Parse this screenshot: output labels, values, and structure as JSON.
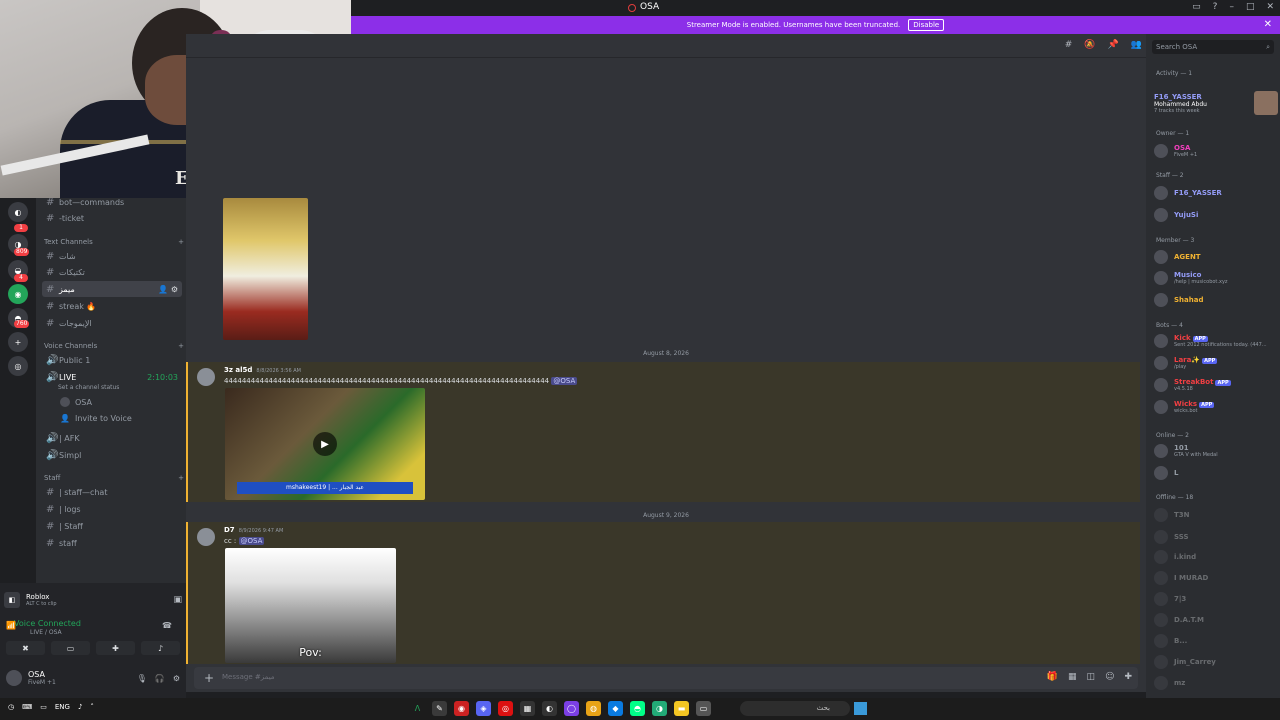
{
  "window": {
    "title": "OSA"
  },
  "banner": {
    "text": "Streamer Mode is enabled. Usernames have been truncated.",
    "button": "Disable"
  },
  "webcam": {
    "shirt_text": "Emira"
  },
  "rail": {
    "badges": [
      "1",
      "809",
      "4",
      "760"
    ]
  },
  "channels": {
    "top": [
      {
        "name": "bot—commands"
      },
      {
        "name": "-ticket"
      }
    ],
    "text_category": "Text Channels",
    "text": [
      {
        "name": "شات"
      },
      {
        "name": "تكتيكات"
      },
      {
        "name": "ميمز"
      },
      {
        "name": "streak 🔥"
      },
      {
        "name": "الإيموجات"
      }
    ],
    "voice_category": "Voice Channels",
    "voice": [
      {
        "name": "Public 1"
      },
      {
        "name": "LIVE",
        "timer": "2:10:03",
        "status": "Set a channel status"
      }
    ],
    "voice_members": [
      {
        "name": "OSA"
      },
      {
        "name": "Invite to Voice"
      }
    ],
    "voice2": [
      {
        "name": "| AFK"
      },
      {
        "name": "Simpl"
      }
    ],
    "staff_category": "Staff",
    "staff": [
      {
        "name": "| staff—chat"
      },
      {
        "name": "| logs"
      },
      {
        "name": "| Staff"
      },
      {
        "name": "staff"
      }
    ]
  },
  "panel": {
    "game": "Roblox",
    "game_sub": "ALT  C  to clip",
    "voice_connected": "Voice Connected",
    "voice_sub": "LIVE / OSA",
    "user_name": "OSA",
    "user_status": "FiveM +1"
  },
  "chat": {
    "dates": [
      "August 8, 2026",
      "August 9, 2026"
    ],
    "msg1": {
      "author": "3z al5d",
      "time": "8/8/2026 3:56 AM",
      "text": "4444444444444444444444444444444444444444444444444444444444444444444444444",
      "mention": "@OSA",
      "video_caption": "mshakeest19 | ... عبد الجبار"
    },
    "msg2": {
      "author": "D7",
      "time": "8/9/2026 9:47 AM",
      "text": "cc :",
      "mention": "@OSA",
      "photo_caption": "Pov:"
    },
    "composer_placeholder": "Message #ميمز"
  },
  "members": {
    "search_placeholder": "Search OSA",
    "activity_header": "Activity — 1",
    "activity": {
      "name": "F16_YASSER",
      "song": "Mohammed Abdu",
      "sub": "7 tracks this week"
    },
    "owner_header": "Owner — 1",
    "owner": [
      {
        "name": "OSA",
        "sub": "FiveM +1",
        "color": "#f23fbd"
      }
    ],
    "staff_header": "Staff — 2",
    "staff": [
      {
        "name": "F16_YASSER",
        "sub": "",
        "color": "#949cf7"
      },
      {
        "name": "YujuSi",
        "sub": "",
        "color": "#949cf7"
      }
    ],
    "member_header": "Member — 3",
    "member": [
      {
        "name": "AGENT",
        "sub": "",
        "color": "#f0b232"
      },
      {
        "name": "Musico",
        "sub": "/help | musicobot.xyz",
        "color": "#949cf7"
      },
      {
        "name": "Shahad",
        "sub": "",
        "color": "#f0b232"
      }
    ],
    "bots_header": "Bots — 4",
    "bots": [
      {
        "name": "Kick",
        "sub": "Sent 2012 notifications today. (447...",
        "color": "#f23f43"
      },
      {
        "name": "Lara✨",
        "sub": "/play",
        "color": "#f23f43"
      },
      {
        "name": "StreakBot",
        "sub": "v4.5.18",
        "color": "#f23f43"
      },
      {
        "name": "Wicks",
        "sub": "wicks.bot",
        "color": "#f23f43"
      }
    ],
    "online_header": "Online — 2",
    "online": [
      {
        "name": "101",
        "sub": "GTA V with Medal"
      },
      {
        "name": "L",
        "sub": ""
      }
    ],
    "offline_header": "Offline — 18",
    "offline": [
      {
        "name": "T3N"
      },
      {
        "name": "SSS"
      },
      {
        "name": "i.kind"
      },
      {
        "name": "I MURAD"
      },
      {
        "name": "7|3"
      },
      {
        "name": "D.A.T.M"
      },
      {
        "name": "B..."
      },
      {
        "name": "Jim_Carrey"
      },
      {
        "name": "mz"
      }
    ]
  },
  "taskbar": {
    "lang": "ENG",
    "search": "بحث"
  }
}
